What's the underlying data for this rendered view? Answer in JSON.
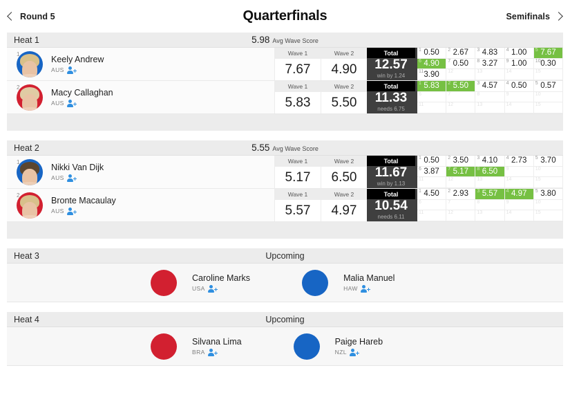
{
  "nav": {
    "prev_label": "Round 5",
    "title": "Quarterfinals",
    "next_label": "Semifinals"
  },
  "labels": {
    "wave1": "Wave 1",
    "wave2": "Wave 2",
    "total": "Total",
    "avg_wave_score": "Avg Wave Score"
  },
  "colors": {
    "counted_wave": "#76c043",
    "total_bg": "#3f3f3f",
    "follow_icon": "#2f8fe0"
  },
  "heats": [
    {
      "name": "Heat 1",
      "status_type": "live",
      "avg_score": "5.98",
      "athletes": [
        {
          "seed": "1",
          "name": "Keely Andrew",
          "nat": "AUS",
          "avatar_bg": "#1765c4",
          "hair": "#d9c089",
          "wave1": "7.67",
          "wave2": "4.90",
          "total": "12.57",
          "note": "win by 1.24",
          "waves": [
            {
              "n": "1",
              "v": "0.50",
              "counted": false
            },
            {
              "n": "2",
              "v": "2.67",
              "counted": false
            },
            {
              "n": "3",
              "v": "4.83",
              "counted": false
            },
            {
              "n": "4",
              "v": "1.00",
              "counted": false
            },
            {
              "n": "5",
              "v": "7.67",
              "counted": true
            },
            {
              "n": "6",
              "v": "4.90",
              "counted": true
            },
            {
              "n": "7",
              "v": "0.50",
              "counted": false
            },
            {
              "n": "8",
              "v": "3.27",
              "counted": false
            },
            {
              "n": "9",
              "v": "1.00",
              "counted": false
            },
            {
              "n": "10",
              "v": "0.30",
              "counted": false
            },
            {
              "n": "11",
              "v": "3.90",
              "counted": false
            },
            {
              "n": "12",
              "v": "",
              "counted": false
            },
            {
              "n": "13",
              "v": "",
              "counted": false
            },
            {
              "n": "14",
              "v": "",
              "counted": false
            },
            {
              "n": "15",
              "v": "",
              "counted": false
            }
          ]
        },
        {
          "seed": "2",
          "name": "Macy Callaghan",
          "nat": "AUS",
          "avatar_bg": "#d22030",
          "hair": "#e0cba4",
          "wave1": "5.83",
          "wave2": "5.50",
          "total": "11.33",
          "note": "needs 6.75",
          "waves": [
            {
              "n": "1",
              "v": "5.83",
              "counted": true
            },
            {
              "n": "2",
              "v": "5.50",
              "counted": true
            },
            {
              "n": "3",
              "v": "4.57",
              "counted": false
            },
            {
              "n": "4",
              "v": "0.50",
              "counted": false
            },
            {
              "n": "5",
              "v": "0.57",
              "counted": false
            },
            {
              "n": "6",
              "v": "",
              "counted": false
            },
            {
              "n": "7",
              "v": "",
              "counted": false
            },
            {
              "n": "8",
              "v": "",
              "counted": false
            },
            {
              "n": "9",
              "v": "",
              "counted": false
            },
            {
              "n": "10",
              "v": "",
              "counted": false
            },
            {
              "n": "11",
              "v": "",
              "counted": false
            },
            {
              "n": "12",
              "v": "",
              "counted": false
            },
            {
              "n": "13",
              "v": "",
              "counted": false
            },
            {
              "n": "14",
              "v": "",
              "counted": false
            },
            {
              "n": "15",
              "v": "",
              "counted": false
            }
          ]
        }
      ]
    },
    {
      "name": "Heat 2",
      "status_type": "live",
      "avg_score": "5.55",
      "athletes": [
        {
          "seed": "1",
          "name": "Nikki Van Dijk",
          "nat": "AUS",
          "avatar_bg": "#1765c4",
          "hair": "#5b4630",
          "wave1": "5.17",
          "wave2": "6.50",
          "total": "11.67",
          "note": "win by 1.13",
          "waves": [
            {
              "n": "1",
              "v": "0.50",
              "counted": false
            },
            {
              "n": "2",
              "v": "3.50",
              "counted": false
            },
            {
              "n": "3",
              "v": "4.10",
              "counted": false
            },
            {
              "n": "4",
              "v": "2.73",
              "counted": false
            },
            {
              "n": "5",
              "v": "3.70",
              "counted": false
            },
            {
              "n": "6",
              "v": "3.87",
              "counted": false
            },
            {
              "n": "7",
              "v": "5.17",
              "counted": true
            },
            {
              "n": "8",
              "v": "6.50",
              "counted": true
            },
            {
              "n": "9",
              "v": "",
              "counted": false
            },
            {
              "n": "10",
              "v": "",
              "counted": false
            },
            {
              "n": "11",
              "v": "",
              "counted": false
            },
            {
              "n": "12",
              "v": "",
              "counted": false
            },
            {
              "n": "13",
              "v": "",
              "counted": false
            },
            {
              "n": "14",
              "v": "",
              "counted": false
            },
            {
              "n": "15",
              "v": "",
              "counted": false
            }
          ]
        },
        {
          "seed": "2",
          "name": "Bronte Macaulay",
          "nat": "AUS",
          "avatar_bg": "#d22030",
          "hair": "#d8c08b",
          "wave1": "5.57",
          "wave2": "4.97",
          "total": "10.54",
          "note": "needs 6.11",
          "waves": [
            {
              "n": "1",
              "v": "4.50",
              "counted": false
            },
            {
              "n": "2",
              "v": "2.93",
              "counted": false
            },
            {
              "n": "3",
              "v": "5.57",
              "counted": true
            },
            {
              "n": "4",
              "v": "4.97",
              "counted": true
            },
            {
              "n": "5",
              "v": "3.80",
              "counted": false
            },
            {
              "n": "6",
              "v": "",
              "counted": false
            },
            {
              "n": "7",
              "v": "",
              "counted": false
            },
            {
              "n": "8",
              "v": "",
              "counted": false
            },
            {
              "n": "9",
              "v": "",
              "counted": false
            },
            {
              "n": "10",
              "v": "",
              "counted": false
            },
            {
              "n": "11",
              "v": "",
              "counted": false
            },
            {
              "n": "12",
              "v": "",
              "counted": false
            },
            {
              "n": "13",
              "v": "",
              "counted": false
            },
            {
              "n": "14",
              "v": "",
              "counted": false
            },
            {
              "n": "15",
              "v": "",
              "counted": false
            }
          ]
        }
      ]
    },
    {
      "name": "Heat 3",
      "status_type": "upcoming",
      "status": "Upcoming",
      "athletes": [
        {
          "name": "Caroline Marks",
          "nat": "USA",
          "avatar_bg": "#d22030",
          "hair": "#6b4a33"
        },
        {
          "name": "Malia Manuel",
          "nat": "HAW",
          "avatar_bg": "#1765c4",
          "hair": "#2e2018"
        }
      ]
    },
    {
      "name": "Heat 4",
      "status_type": "upcoming",
      "status": "Upcoming",
      "athletes": [
        {
          "name": "Silvana Lima",
          "nat": "BRA",
          "avatar_bg": "#d22030",
          "hair": "#241a14"
        },
        {
          "name": "Paige Hareb",
          "nat": "NZL",
          "avatar_bg": "#1765c4",
          "hair": "#e0cf9b"
        }
      ]
    }
  ]
}
